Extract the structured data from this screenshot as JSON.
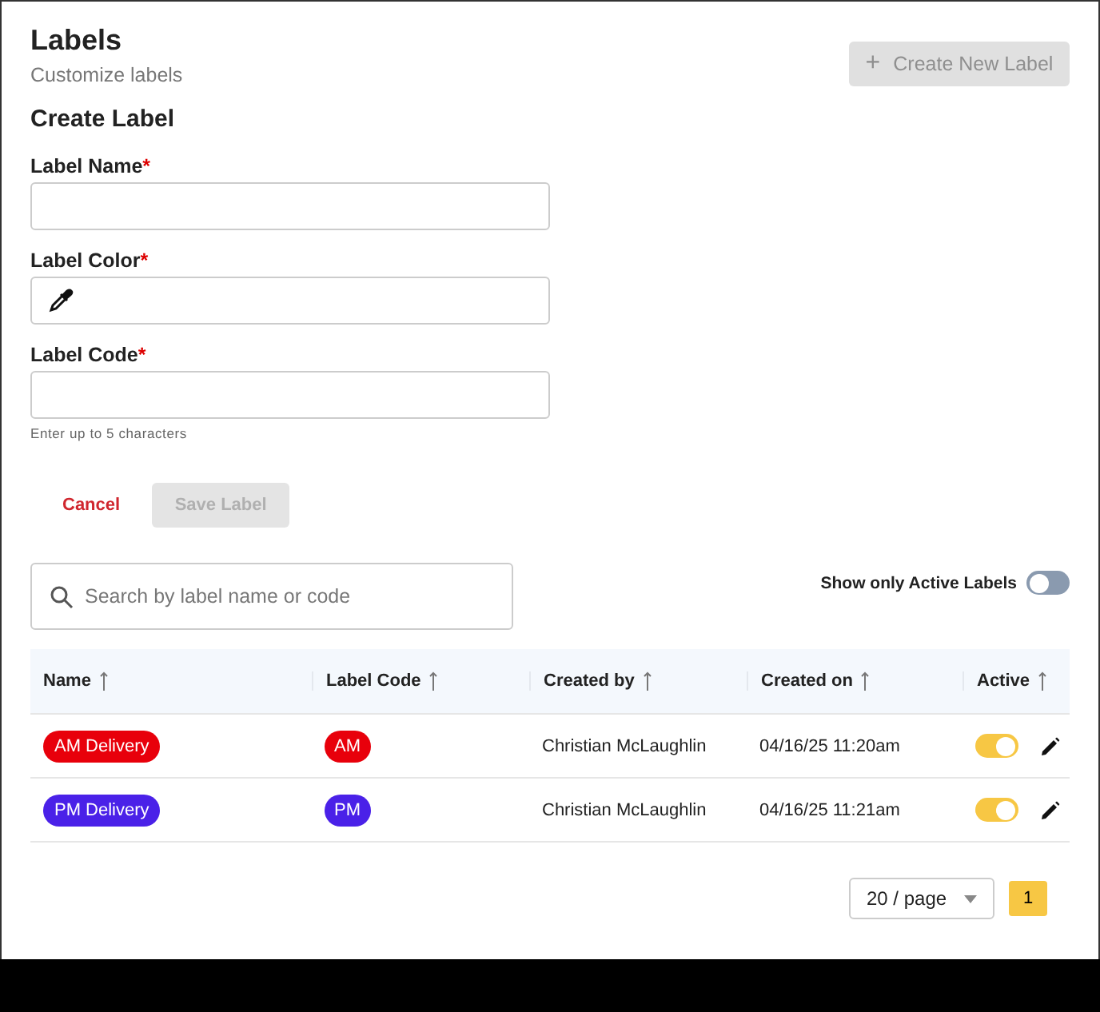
{
  "header": {
    "title": "Labels",
    "subtitle": "Customize labels",
    "create_button": {
      "icon": "+",
      "label": "Create New Label",
      "disabled": true
    }
  },
  "form": {
    "title": "Create Label",
    "fields": [
      {
        "kind": "text",
        "label": "Label Name",
        "required_mark": "*"
      },
      {
        "kind": "color",
        "label": "Label Color",
        "required_mark": "*"
      },
      {
        "kind": "text",
        "label": "Label Code",
        "required_mark": "*",
        "hint": "Enter up to 5 characters"
      }
    ],
    "buttons": [
      {
        "label": "Cancel",
        "kind": "link",
        "disabled": false
      },
      {
        "label": "Save Label",
        "kind": "button",
        "disabled": true
      }
    ]
  },
  "search": {
    "placeholder": "Search by label name or code"
  },
  "active_filter": {
    "label": "Show only Active Labels",
    "on": false
  },
  "table": {
    "columns": [
      "Name",
      "Label Code",
      "Created by",
      "Created on",
      "Active"
    ],
    "rows": [
      {
        "name": "AM Delivery",
        "code": "AM",
        "color": "#e8000b",
        "created_by": "Christian McLaughlin",
        "created_on": "04/16/25 11:20am",
        "active": true
      },
      {
        "name": "PM Delivery",
        "code": "PM",
        "color": "#4a21e8",
        "created_by": "Christian McLaughlin",
        "created_on": "04/16/25 11:21am",
        "active": true
      }
    ]
  },
  "pagination": {
    "page_size": "20 / page",
    "pages": [
      {
        "label": "1",
        "selected": true
      }
    ]
  }
}
